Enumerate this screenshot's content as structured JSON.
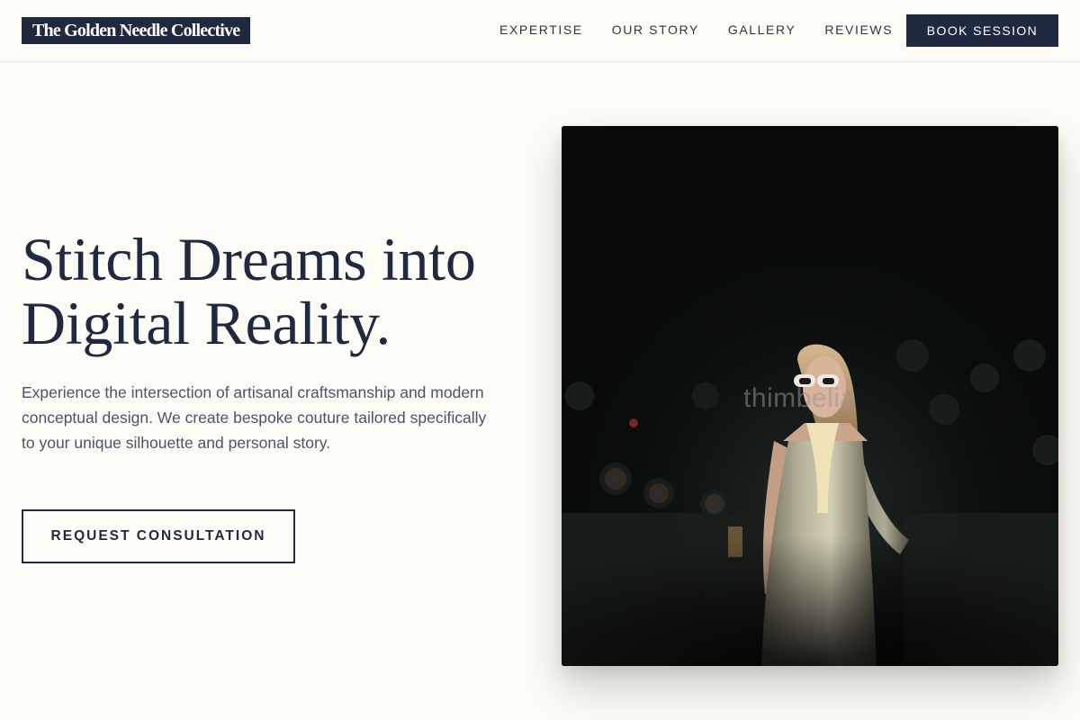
{
  "header": {
    "logo_text": "The Golden Needle Collective",
    "nav": [
      {
        "label": "EXPERTISE"
      },
      {
        "label": "OUR STORY"
      },
      {
        "label": "GALLERY"
      },
      {
        "label": "REVIEWS"
      }
    ],
    "cta_label": "BOOK SESSION"
  },
  "hero": {
    "title_line1": "Stitch Dreams into",
    "title_line2": "Digital Reality.",
    "description": "Experience the intersection of artisanal craftsmanship and modern conceptual design. We create bespoke couture tailored specifically to your unique silhouette and personal story.",
    "cta_label": "REQUEST CONSULTATION",
    "image_watermark": "thimbelia"
  },
  "colors": {
    "background": "#fcfbf5",
    "primary": "#1f2940",
    "body_text": "#4b5568"
  }
}
